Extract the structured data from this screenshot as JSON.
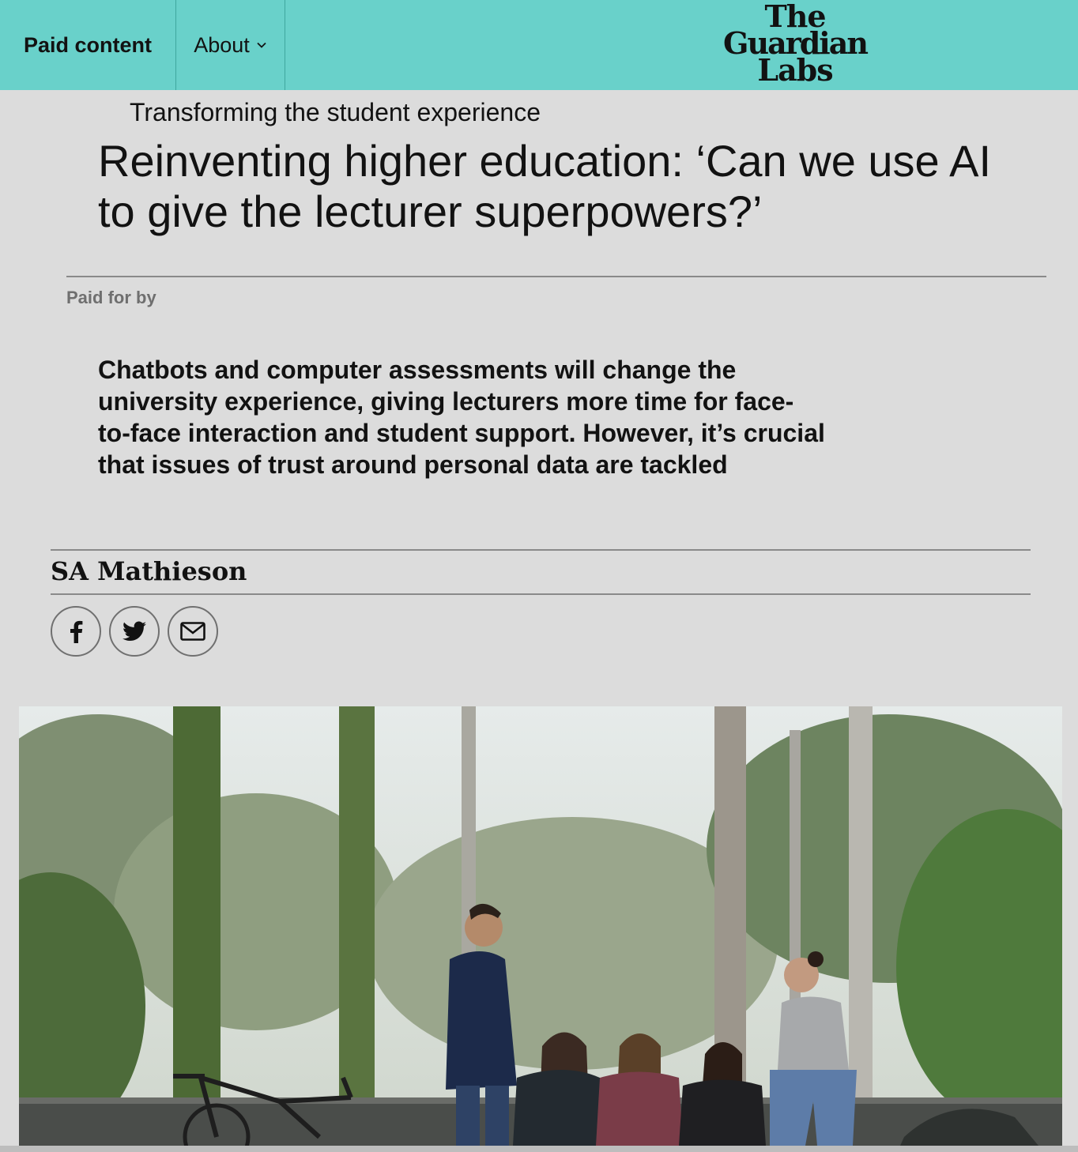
{
  "header": {
    "paid_label": "Paid content",
    "about_label": "About",
    "logo": {
      "line1": "The",
      "line2": "Guardian",
      "line3": "Labs"
    },
    "background_color": "#69d1ca"
  },
  "article": {
    "kicker": "Transforming the student experience",
    "headline": "Reinventing higher education: ‘Can we use AI to give the lecturer superpowers?’",
    "paid_for_by": "Paid for by",
    "standfirst": "Chatbots and computer assessments will change the university experience, giving lecturers more time for face-to-face interaction and student support. However, it’s crucial that issues of trust around personal data are tackled",
    "byline": "SA Mathieson"
  },
  "share": {
    "icons": [
      "facebook-icon",
      "twitter-icon",
      "email-icon"
    ]
  },
  "photo": {
    "subject": "students-in-park-photo"
  }
}
